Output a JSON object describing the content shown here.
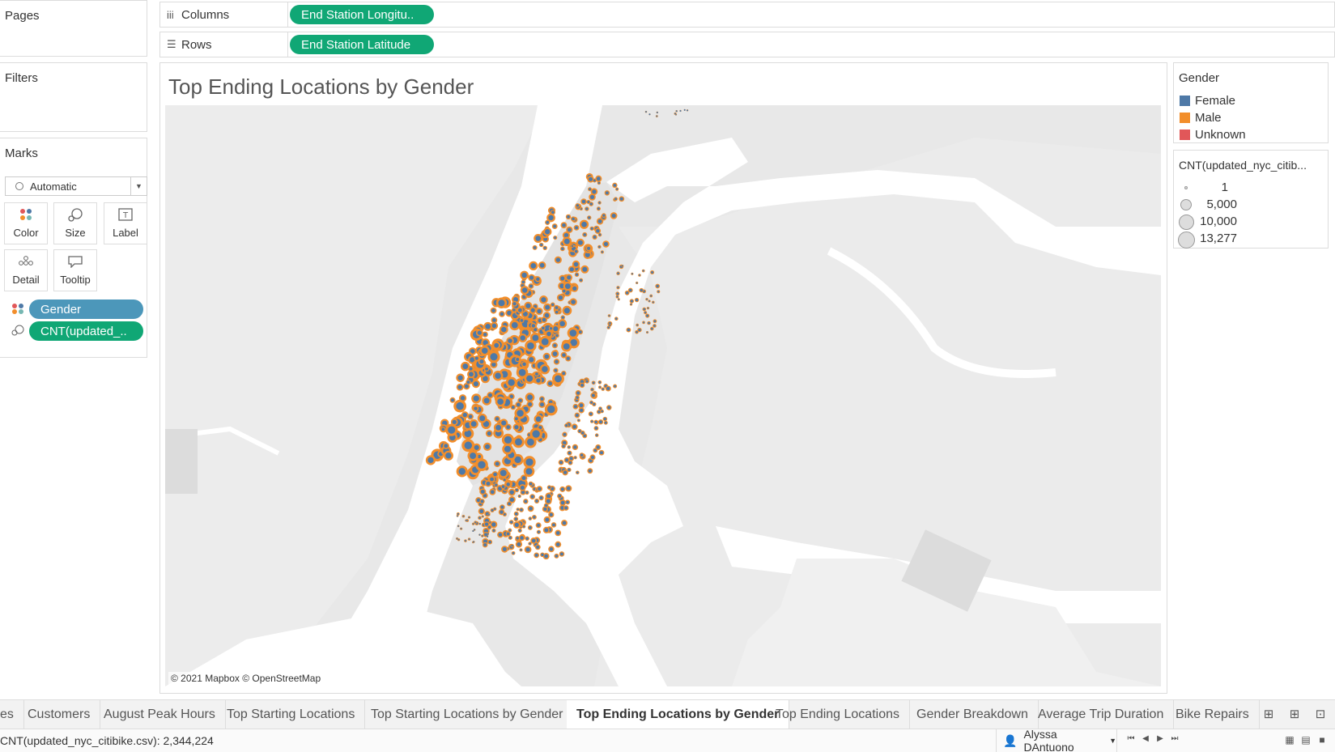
{
  "pages": {
    "title": "Pages"
  },
  "filters": {
    "title": "Filters"
  },
  "marks": {
    "title": "Marks",
    "type": "Automatic",
    "buttons": [
      {
        "label": "Color",
        "icon": "color-dots-icon"
      },
      {
        "label": "Size",
        "icon": "size-icon"
      },
      {
        "label": "Label",
        "icon": "label-icon"
      },
      {
        "label": "Detail",
        "icon": "detail-icon"
      },
      {
        "label": "Tooltip",
        "icon": "tooltip-icon"
      }
    ],
    "fields": [
      {
        "label": "Gender",
        "icon": "color-dots-icon"
      },
      {
        "label": "CNT(updated_..",
        "icon": "size-icon"
      }
    ]
  },
  "shelves": {
    "columns_label": "Columns",
    "columns_pill": "End Station Longitu..",
    "rows_label": "Rows",
    "rows_pill": "End Station Latitude"
  },
  "viz": {
    "title": "Top Ending Locations by Gender",
    "attribution": "© 2021 Mapbox © OpenStreetMap"
  },
  "legend_gender": {
    "title": "Gender",
    "items": [
      {
        "label": "Female",
        "color": "#4e79a7"
      },
      {
        "label": "Male",
        "color": "#f28e2b"
      },
      {
        "label": "Unknown",
        "color": "#e15759"
      }
    ]
  },
  "legend_size": {
    "title": "CNT(updated_nyc_citib...",
    "items": [
      "1",
      "5,000",
      "10,000",
      "13,277"
    ]
  },
  "tabs": {
    "items": [
      "es",
      "Customers",
      "August Peak Hours",
      "Top Starting Locations",
      "Top Starting Locations by Gender",
      "Top Ending Locations by Gender",
      "Top Ending Locations",
      "Gender Breakdown",
      "Average Trip Duration",
      "Bike Repairs"
    ],
    "active": "Top Ending Locations by Gender"
  },
  "status": {
    "summary": "CNT(updated_nyc_citibike.csv): 2,344,224",
    "user": "Alyssa DAntuono"
  }
}
